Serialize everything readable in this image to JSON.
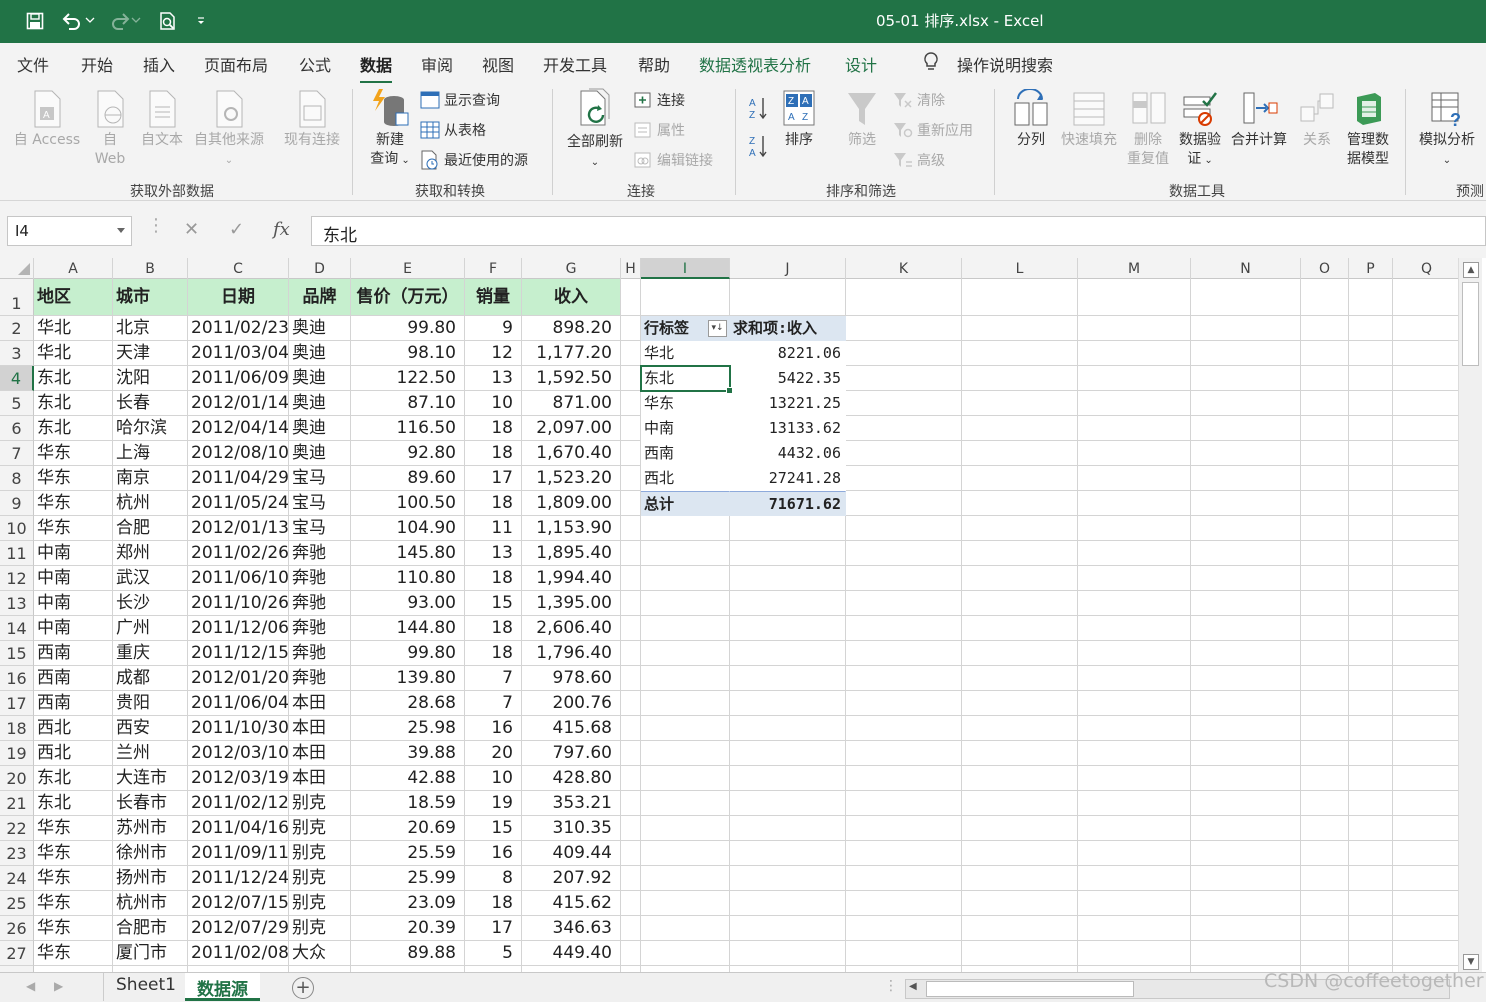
{
  "titlebar": {
    "title": "05-01 排序.xlsx  -  Excel",
    "bg_color": "#217346",
    "icons": [
      "save-icon",
      "undo-icon",
      "redo-icon",
      "print-preview-icon",
      "customize-qat-icon"
    ]
  },
  "tabs": [
    {
      "label": "文件"
    },
    {
      "label": "开始"
    },
    {
      "label": "插入"
    },
    {
      "label": "页面布局"
    },
    {
      "label": "公式"
    },
    {
      "label": "数据",
      "active": true
    },
    {
      "label": "审阅"
    },
    {
      "label": "视图"
    },
    {
      "label": "开发工具"
    },
    {
      "label": "帮助"
    },
    {
      "label": "数据透视表分析",
      "contextual": true
    },
    {
      "label": "设计",
      "contextual": true
    },
    {
      "label": "操作说明搜索",
      "icon": "lightbulb-icon"
    }
  ],
  "ribbon": {
    "get_external": {
      "group": "获取外部数据",
      "access": "自 Access",
      "web_1": "自",
      "web_2": "Web",
      "text": "自文本",
      "other": "自其他来源",
      "existing": "现有连接"
    },
    "get_transform": {
      "group": "获取和转换",
      "new_query_1": "新建",
      "new_query_2": "查询",
      "show_queries": "显示查询",
      "from_table": "从表格",
      "recent_sources": "最近使用的源"
    },
    "connections": {
      "group": "连接",
      "refresh_all": "全部刷新",
      "connections": "连接",
      "properties": "属性",
      "edit_links": "编辑链接"
    },
    "sort_filter": {
      "group": "排序和筛选",
      "sort": "排序",
      "filter": "筛选",
      "clear": "清除",
      "reapply": "重新应用",
      "advanced": "高级"
    },
    "data_tools": {
      "group": "数据工具",
      "text_to_columns": "分列",
      "flash_fill": "快速填充",
      "remove_dup_1": "删除",
      "remove_dup_2": "重复值",
      "validation_1": "数据验",
      "validation_2": "证",
      "consolidate": "合并计算",
      "relationships": "关系",
      "data_model_1": "管理数",
      "data_model_2": "据模型"
    },
    "forecast": {
      "group": "预测",
      "what_if": "模拟分析"
    }
  },
  "formula_bar": {
    "name_box": "I4",
    "content": "东北",
    "cancel_glyph": "✕",
    "enter_glyph": "✓",
    "fx_glyph": "fx"
  },
  "columns": [
    "A",
    "B",
    "C",
    "D",
    "E",
    "F",
    "G",
    "H",
    "I",
    "J",
    "K",
    "L",
    "M",
    "N",
    "O",
    "P",
    "Q"
  ],
  "selected_column": "I",
  "selected_row": 4,
  "header_row": [
    "地区",
    "城市",
    "日期",
    "品牌",
    "售价（万元）",
    "销量",
    "收入"
  ],
  "rows": [
    [
      "华北",
      "北京",
      "2011/02/23",
      "奥迪",
      "99.80",
      "9",
      "898.20"
    ],
    [
      "华北",
      "天津",
      "2011/03/04",
      "奥迪",
      "98.10",
      "12",
      "1,177.20"
    ],
    [
      "东北",
      "沈阳",
      "2011/06/09",
      "奥迪",
      "122.50",
      "13",
      "1,592.50"
    ],
    [
      "东北",
      "长春",
      "2012/01/14",
      "奥迪",
      "87.10",
      "10",
      "871.00"
    ],
    [
      "东北",
      "哈尔滨",
      "2012/04/14",
      "奥迪",
      "116.50",
      "18",
      "2,097.00"
    ],
    [
      "华东",
      "上海",
      "2012/08/10",
      "奥迪",
      "92.80",
      "18",
      "1,670.40"
    ],
    [
      "华东",
      "南京",
      "2011/04/29",
      "宝马",
      "89.60",
      "17",
      "1,523.20"
    ],
    [
      "华东",
      "杭州",
      "2011/05/24",
      "宝马",
      "100.50",
      "18",
      "1,809.00"
    ],
    [
      "华东",
      "合肥",
      "2012/01/13",
      "宝马",
      "104.90",
      "11",
      "1,153.90"
    ],
    [
      "中南",
      "郑州",
      "2011/02/26",
      "奔驰",
      "145.80",
      "13",
      "1,895.40"
    ],
    [
      "中南",
      "武汉",
      "2011/06/10",
      "奔驰",
      "110.80",
      "18",
      "1,994.40"
    ],
    [
      "中南",
      "长沙",
      "2011/10/26",
      "奔驰",
      "93.00",
      "15",
      "1,395.00"
    ],
    [
      "中南",
      "广州",
      "2011/12/06",
      "奔驰",
      "144.80",
      "18",
      "2,606.40"
    ],
    [
      "西南",
      "重庆",
      "2011/12/15",
      "奔驰",
      "99.80",
      "18",
      "1,796.40"
    ],
    [
      "西南",
      "成都",
      "2012/01/20",
      "奔驰",
      "139.80",
      "7",
      "978.60"
    ],
    [
      "西南",
      "贵阳",
      "2011/06/04",
      "本田",
      "28.68",
      "7",
      "200.76"
    ],
    [
      "西北",
      "西安",
      "2011/10/30",
      "本田",
      "25.98",
      "16",
      "415.68"
    ],
    [
      "西北",
      "兰州",
      "2012/03/10",
      "本田",
      "39.88",
      "20",
      "797.60"
    ],
    [
      "东北",
      "大连市",
      "2012/03/19",
      "本田",
      "42.88",
      "10",
      "428.80"
    ],
    [
      "东北",
      "长春市",
      "2011/02/12",
      "别克",
      "18.59",
      "19",
      "353.21"
    ],
    [
      "华东",
      "苏州市",
      "2011/04/16",
      "别克",
      "20.69",
      "15",
      "310.35"
    ],
    [
      "华东",
      "徐州市",
      "2011/09/11",
      "别克",
      "25.59",
      "16",
      "409.44"
    ],
    [
      "华东",
      "扬州市",
      "2011/12/24",
      "别克",
      "25.99",
      "8",
      "207.92"
    ],
    [
      "华东",
      "杭州市",
      "2012/07/15",
      "别克",
      "23.09",
      "18",
      "415.62"
    ],
    [
      "华东",
      "合肥市",
      "2012/07/29",
      "别克",
      "20.39",
      "17",
      "346.63"
    ],
    [
      "华东",
      "厦门市",
      "2011/02/08",
      "大众",
      "89.88",
      "5",
      "449.40"
    ]
  ],
  "pivot": {
    "row_label": "行标签",
    "value_label": "求和项:收入",
    "items": [
      {
        "label": "华北",
        "value": "8221.06"
      },
      {
        "label": "东北",
        "value": "5422.35"
      },
      {
        "label": "华东",
        "value": "13221.25"
      },
      {
        "label": "中南",
        "value": "13133.62"
      },
      {
        "label": "西南",
        "value": "4432.06"
      },
      {
        "label": "西北",
        "value": "27241.28"
      }
    ],
    "total_label": "总计",
    "total_value": "71671.62",
    "header_color": "#dce6f1"
  },
  "sheets": [
    {
      "label": "Sheet1",
      "active": false
    },
    {
      "label": "数据源",
      "active": true
    }
  ],
  "watermark": "CSDN @coffeetogether",
  "colors": {
    "accent": "#217346",
    "header_fill": "#c6efce"
  }
}
